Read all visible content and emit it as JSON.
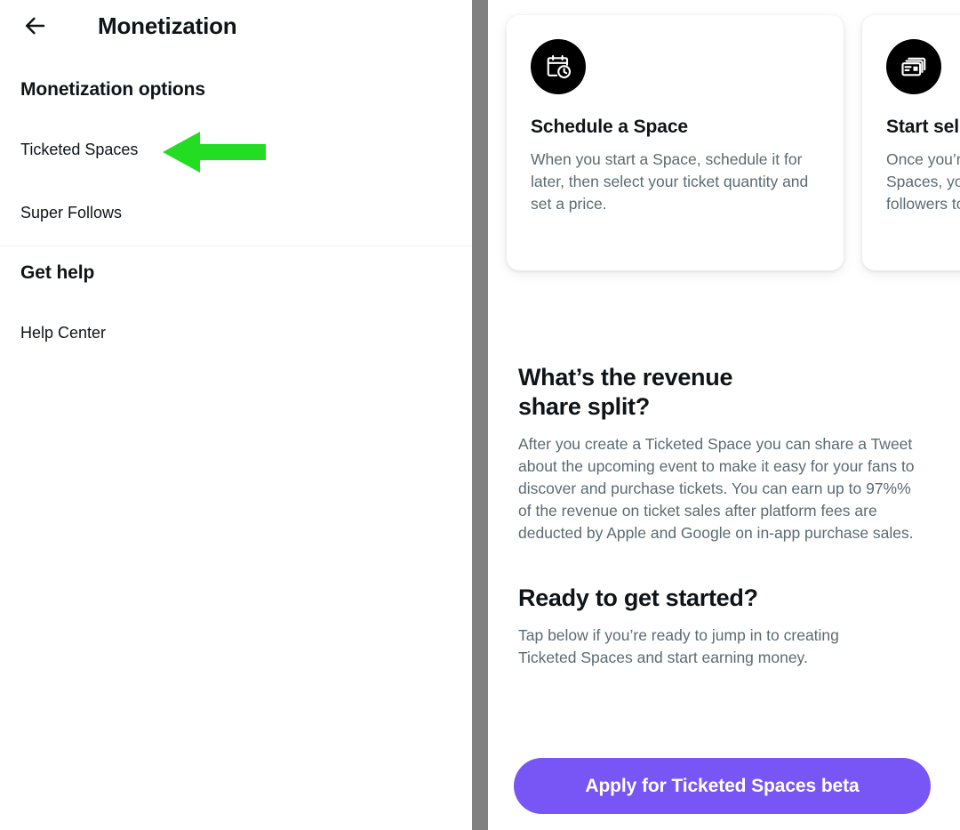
{
  "sidebar": {
    "back_icon": "back-arrow-icon",
    "title": "Monetization",
    "sections": [
      {
        "heading": "Monetization options",
        "items": [
          {
            "label": "Ticketed Spaces"
          },
          {
            "label": "Super Follows"
          }
        ]
      },
      {
        "heading": "Get help",
        "items": [
          {
            "label": "Help Center"
          }
        ]
      }
    ],
    "annotation": {
      "type": "arrow-left",
      "color": "#22dd22",
      "points_at": "Ticketed Spaces"
    }
  },
  "detail": {
    "cards": [
      {
        "icon": "calendar-clock-icon",
        "title": "Schedule a Space",
        "body": "When you start a Space, schedule it for later, then select your ticket quantity and set a price."
      },
      {
        "icon": "tickets-cards-icon",
        "title": "Start selling",
        "body": "Once you’re approved for Ticketed Spaces, you can invite all of your followers to purchase tickets."
      }
    ],
    "sections": [
      {
        "heading_line1": "What’s the revenue",
        "heading_line2": "share split?",
        "body": "After you create a Ticketed Space you can share a Tweet about the upcoming event to make it easy for your fans to discover and purchase tickets. You can earn up to 97%% of the revenue on ticket sales after platform fees are deducted by Apple and Google on in-app purchase sales."
      },
      {
        "heading_line1": "Ready to get started?",
        "body": "Tap below if you’re ready to jump in to creating Ticketed Spaces and start earning money."
      }
    ],
    "cta_label": "Apply for Ticketed Spaces beta",
    "cta_color": "#7856f5"
  }
}
